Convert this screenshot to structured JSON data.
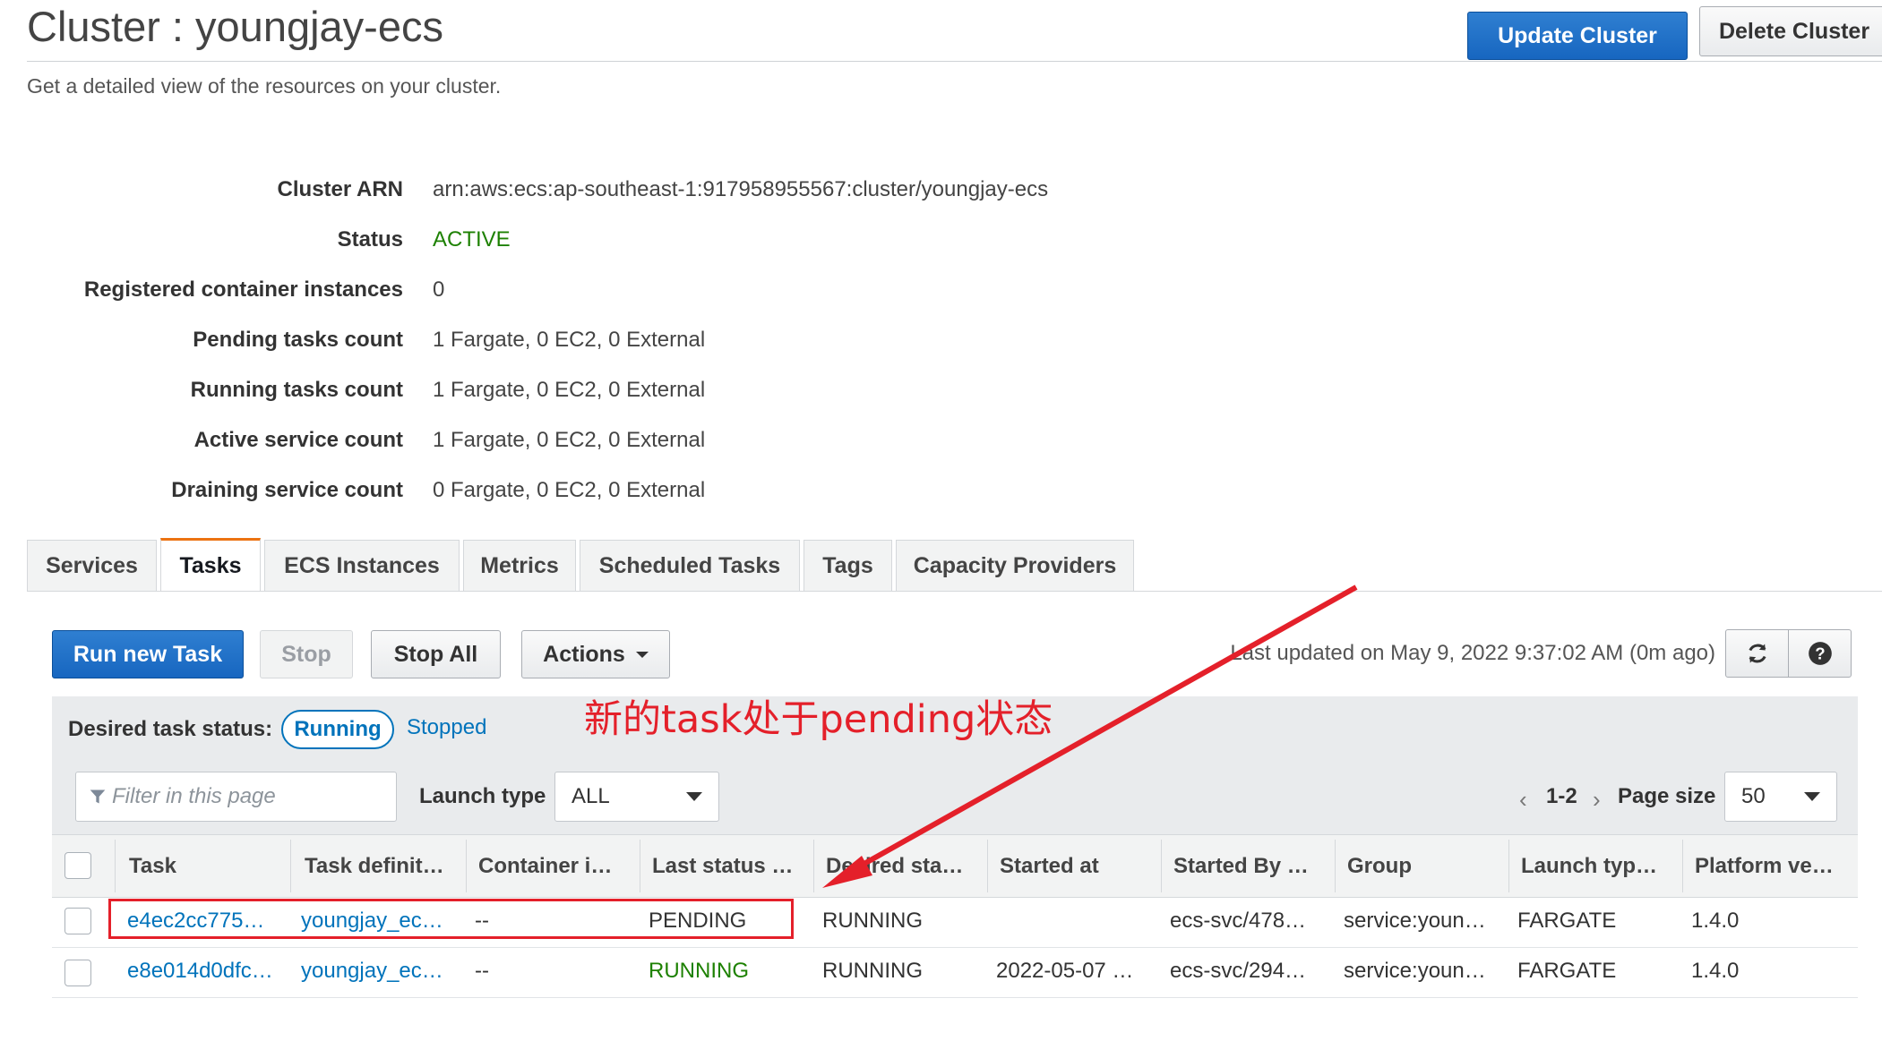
{
  "header": {
    "title": "Cluster : youngjay-ecs",
    "subtitle": "Get a detailed view of the resources on your cluster.",
    "update_button": "Update Cluster",
    "delete_button": "Delete Cluster"
  },
  "details": [
    {
      "label": "Cluster ARN",
      "value": "arn:aws:ecs:ap-southeast-1:917958955567:cluster/youngjay-ecs"
    },
    {
      "label": "Status",
      "value": "ACTIVE"
    },
    {
      "label": "Registered container instances",
      "value": "0"
    },
    {
      "label": "Pending tasks count",
      "value": "1 Fargate, 0 EC2, 0 External"
    },
    {
      "label": "Running tasks count",
      "value": "1 Fargate, 0 EC2, 0 External"
    },
    {
      "label": "Active service count",
      "value": "1 Fargate, 0 EC2, 0 External"
    },
    {
      "label": "Draining service count",
      "value": "0 Fargate, 0 EC2, 0 External"
    }
  ],
  "tabs": [
    "Services",
    "Tasks",
    "ECS Instances",
    "Metrics",
    "Scheduled Tasks",
    "Tags",
    "Capacity Providers"
  ],
  "selected_tab": "Tasks",
  "toolbar": {
    "run_new_task": "Run new Task",
    "stop": "Stop",
    "stop_all": "Stop All",
    "actions": "Actions",
    "last_updated": "Last updated on May 9, 2022 9:37:02 AM (0m ago)",
    "refresh_icon": "refresh-icon",
    "help_icon": "help-icon"
  },
  "desired_status": {
    "label": "Desired task status:",
    "running": "Running",
    "stopped": "Stopped",
    "selected": "Running"
  },
  "filter": {
    "placeholder": "Filter in this page",
    "launch_type_label": "Launch type",
    "launch_type_value": "ALL",
    "pagination": "1-2",
    "page_size_label": "Page size",
    "page_size_value": "50"
  },
  "table": {
    "headers": [
      "Task",
      "Task definit…",
      "Container i…",
      "Last status …",
      "Desired sta…",
      "Started at",
      "Started By …",
      "Group",
      "Launch typ…",
      "Platform ve…"
    ],
    "rows": [
      {
        "task": "e4ec2cc775…",
        "task_definition": "youngjay_ec…",
        "container_instance": "--",
        "last_status": "PENDING",
        "desired_status": "RUNNING",
        "started_at": "",
        "started_by": "ecs-svc/478…",
        "group": "service:youn…",
        "launch_type": "FARGATE",
        "platform_version": "1.4.0"
      },
      {
        "task": "e8e014d0dfc…",
        "task_definition": "youngjay_ec…",
        "container_instance": "--",
        "last_status": "RUNNING",
        "desired_status": "RUNNING",
        "started_at": "2022-05-07 …",
        "started_by": "ecs-svc/294…",
        "group": "service:youn…",
        "launch_type": "FARGATE",
        "platform_version": "1.4.0"
      }
    ]
  },
  "annotation": {
    "text": "新的task处于pending状态",
    "color": "#e4202a"
  },
  "colors": {
    "primary_button": "#1766c0",
    "active_status": "#1d8102",
    "link": "#0073bb",
    "tab_accent": "#ec7211"
  }
}
